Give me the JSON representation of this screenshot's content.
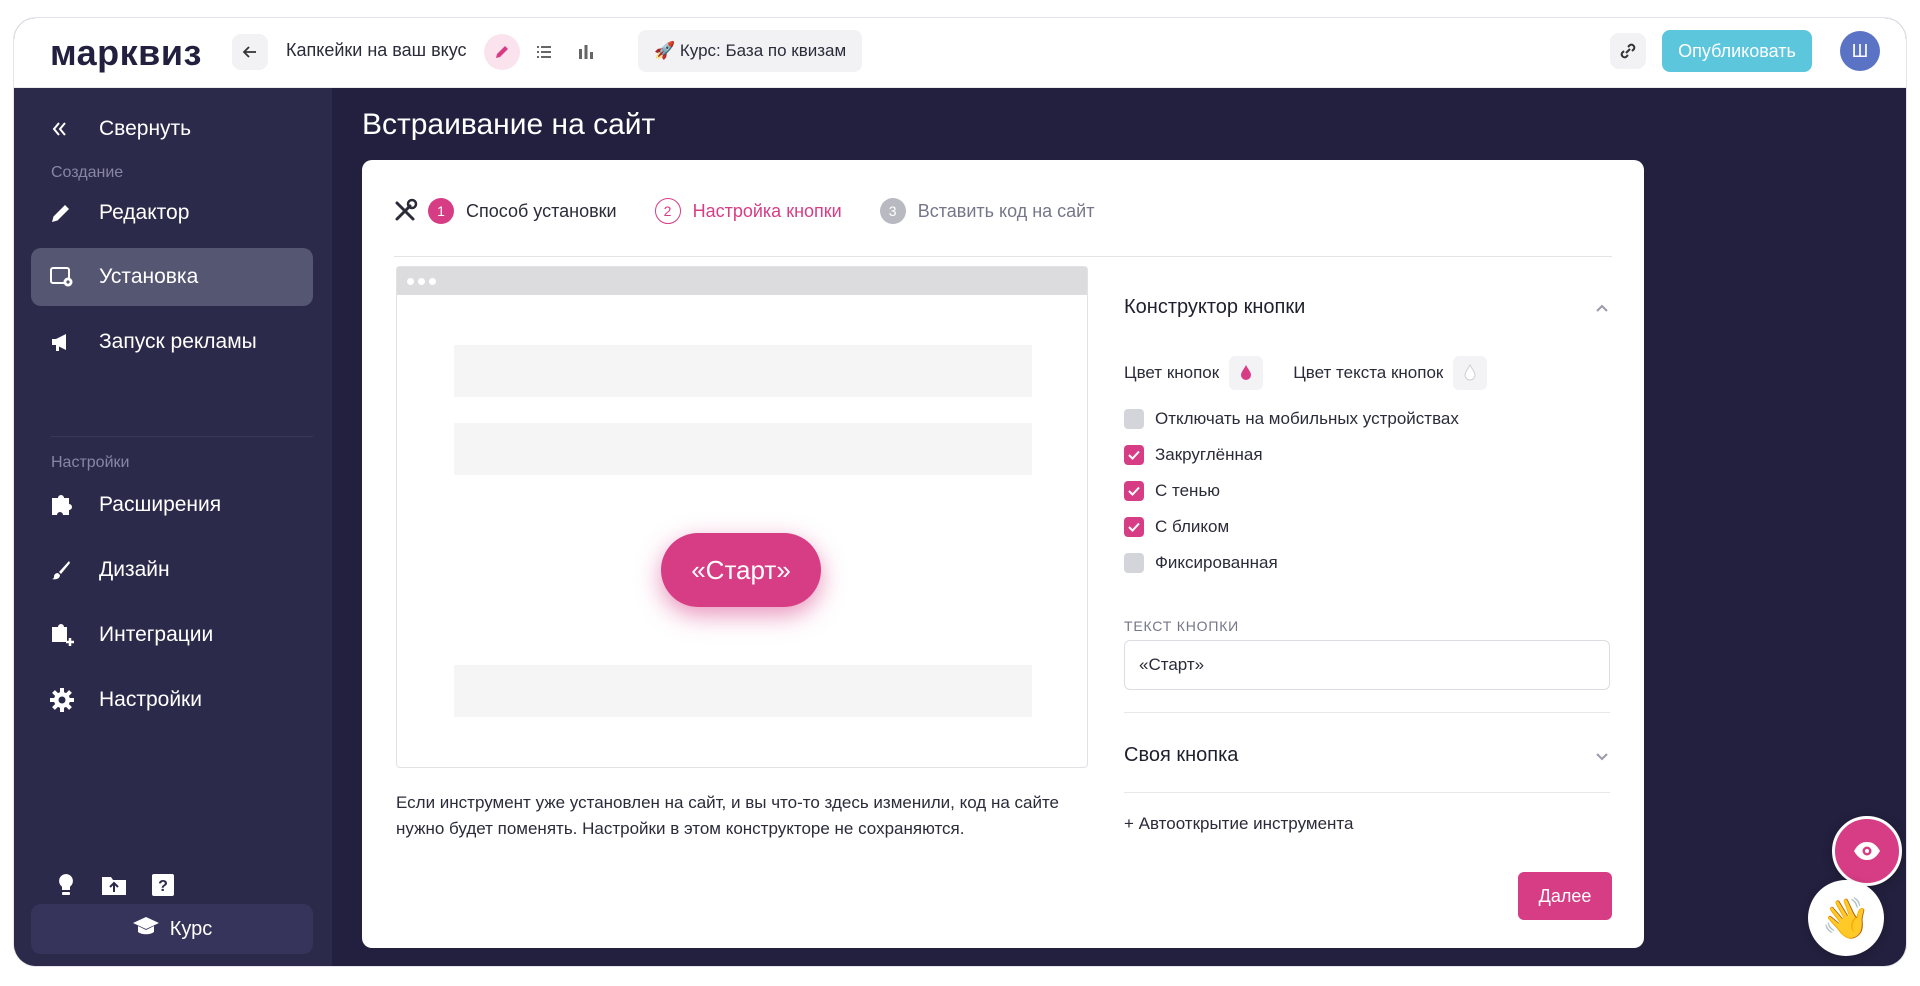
{
  "header": {
    "logo": "марквиз",
    "quiz_name": "Капкейки на ваш вкус",
    "course_chip": "🚀 Курс: База по квизам",
    "publish_label": "Опубликовать",
    "avatar_initial": "Ш"
  },
  "sidebar": {
    "collapse_label": "Свернуть",
    "section_create": "Создание",
    "section_settings": "Настройки",
    "items": [
      {
        "label": "Редактор",
        "icon": "pencil-icon"
      },
      {
        "label": "Установка",
        "icon": "install-icon",
        "active": true
      },
      {
        "label": "Запуск рекламы",
        "icon": "megaphone-icon"
      },
      {
        "label": "Расширения",
        "icon": "puzzle-icon"
      },
      {
        "label": "Дизайн",
        "icon": "brush-icon"
      },
      {
        "label": "Интеграции",
        "icon": "integration-icon"
      },
      {
        "label": "Настройки",
        "icon": "gear-icon"
      }
    ],
    "course_label": "Курс"
  },
  "main": {
    "title": "Встраивание на сайт",
    "steps": [
      {
        "num": "1",
        "label": "Способ установки"
      },
      {
        "num": "2",
        "label": "Настройка кнопки"
      },
      {
        "num": "3",
        "label": "Вставить код на сайт"
      }
    ],
    "preview_button": "«Старт»",
    "note": "Если инструмент уже установлен на сайт, и вы что-то здесь изменили, код на сайте нужно будет поменять. Настройки в этом конструкторе не сохраняются.",
    "next_label": "Далее"
  },
  "builder": {
    "title": "Конструктор кнопки",
    "button_color_label": "Цвет кнопок",
    "text_color_label": "Цвет текста кнопок",
    "options": [
      {
        "label": "Отключать на мобильных устройствах",
        "checked": false
      },
      {
        "label": "Закруглённая",
        "checked": true
      },
      {
        "label": "С тенью",
        "checked": true
      },
      {
        "label": "С бликом",
        "checked": true
      },
      {
        "label": "Фиксированная",
        "checked": false
      }
    ],
    "text_field_label": "ТЕКСТ КНОПКИ",
    "text_field_value": "«Старт»",
    "own_button_label": "Своя кнопка",
    "autoopen_label": "+ Автооткрытие инструмента"
  },
  "colors": {
    "accent": "#d73d85",
    "sidebar": "#2c2a4a",
    "publish": "#5cc6dd"
  }
}
